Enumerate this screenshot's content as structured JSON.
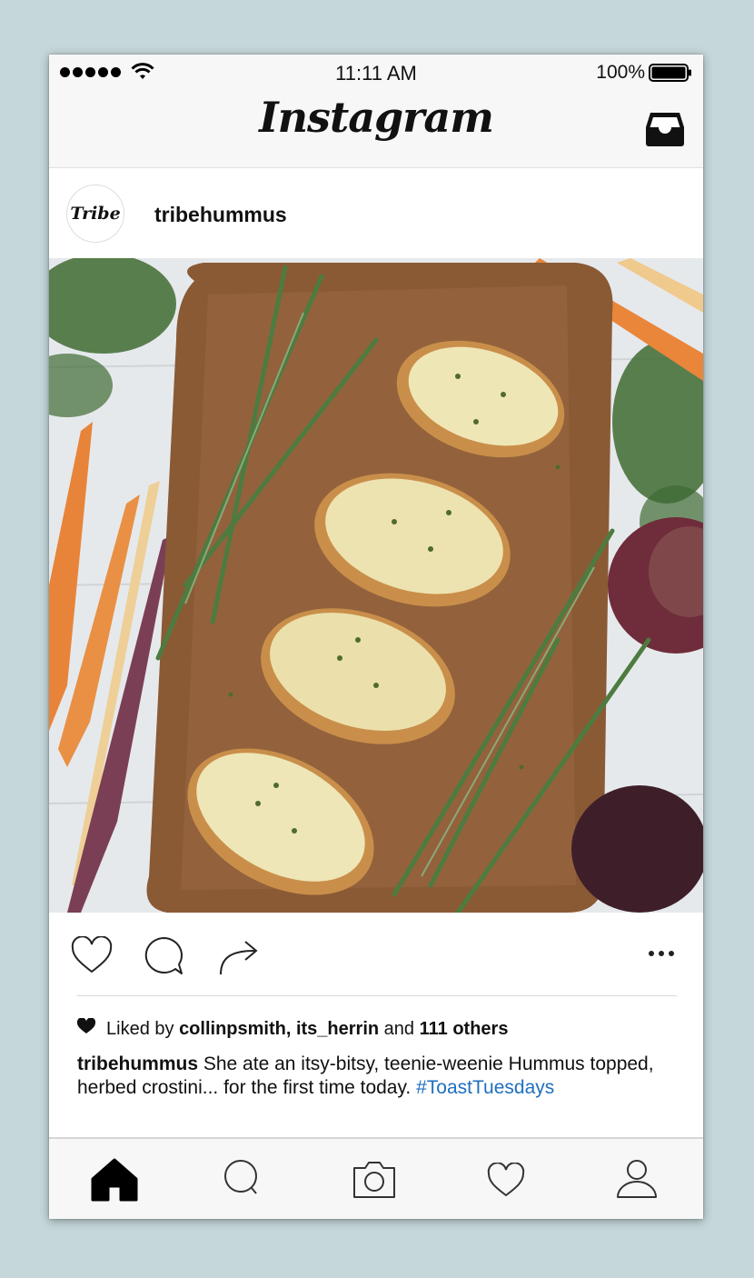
{
  "status_bar": {
    "time": "11:11 AM",
    "battery_percent": "100%",
    "signal_bars": 5
  },
  "header": {
    "app_title": "Instagram",
    "inbox_icon": "inbox-tray-icon"
  },
  "post": {
    "avatar_text": "Tribe",
    "username": "tribehummus",
    "image_icon": "food-photo",
    "actions": {
      "like_icon": "heart-outline-icon",
      "comment_icon": "comment-bubble-icon",
      "share_icon": "share-arrow-icon",
      "more_icon": "more-dots-icon"
    },
    "likes": {
      "prefix": "Liked by",
      "users": "collinpsmith, its_herrin",
      "joiner": "and",
      "others": "111 others"
    },
    "caption": {
      "username": "tribehummus",
      "text": "She ate an itsy-bitsy, teenie-weenie Hummus topped, herbed crostini... for the first time today.",
      "hashtag": "#ToastTuesdays"
    }
  },
  "tabbar": {
    "items": [
      {
        "icon": "home-icon",
        "active": true
      },
      {
        "icon": "search-icon",
        "active": false
      },
      {
        "icon": "camera-icon",
        "active": false
      },
      {
        "icon": "heart-icon",
        "active": false
      },
      {
        "icon": "profile-icon",
        "active": false
      }
    ]
  },
  "colors": {
    "background": "#c5d7da",
    "hashtag": "#1f6fbf",
    "bars": "#f7f7f7"
  }
}
